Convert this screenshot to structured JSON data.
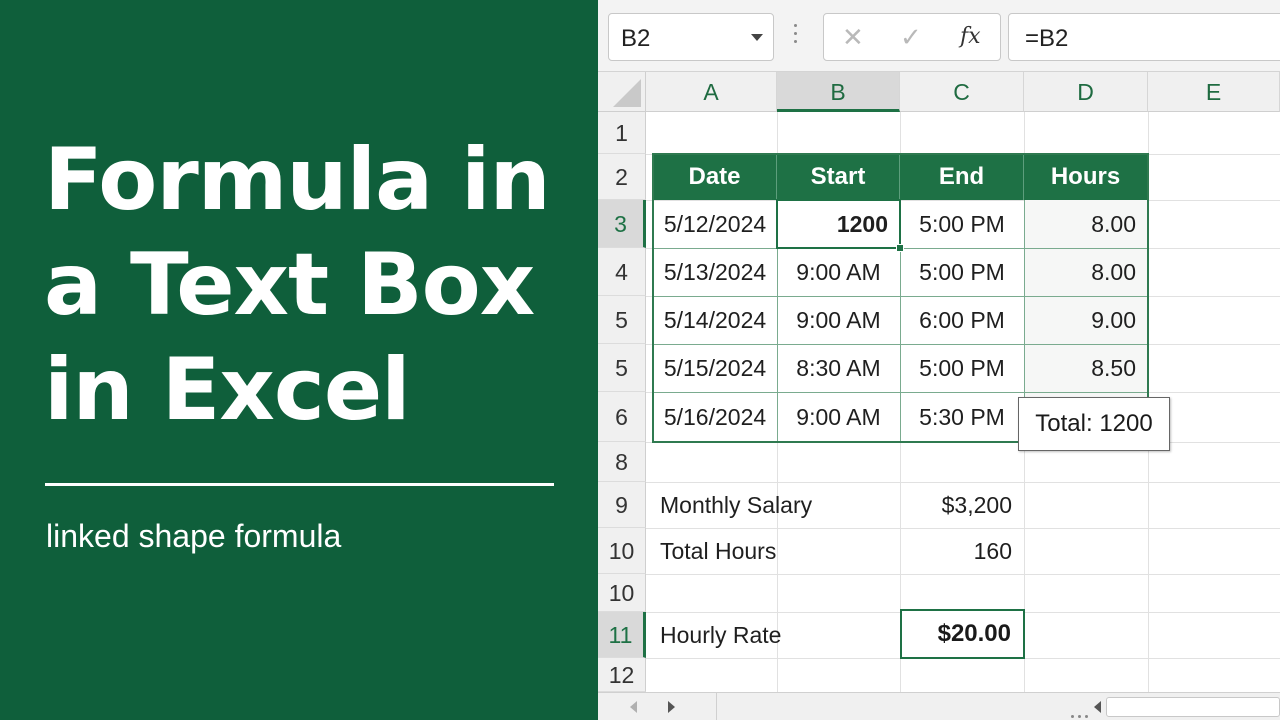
{
  "banner": {
    "title_lines": [
      "Formula in",
      "a Text Box",
      "in Excel"
    ],
    "subtitle": "linked shape formula",
    "bg_color": "#0f5f3b"
  },
  "formula_bar": {
    "name_box": "B2",
    "cancel_icon": "✕",
    "enter_icon": "✓",
    "fx_label": "fx",
    "formula": "=B2"
  },
  "columns": [
    "A",
    "B",
    "C",
    "D",
    "E"
  ],
  "selected_column": "B",
  "rows": [
    "1",
    "2",
    "3",
    "4",
    "5",
    "5",
    "6",
    "8",
    "9",
    "10",
    "10",
    "11",
    "12"
  ],
  "table": {
    "headers": [
      "Date",
      "Start",
      "End",
      "Hours"
    ],
    "rows": [
      [
        "5/12/2024",
        "1200",
        "5:00 PM",
        "8.00"
      ],
      [
        "5/13/2024",
        "9:00 AM",
        "5:00 PM",
        "8.00"
      ],
      [
        "5/14/2024",
        "9:00 AM",
        "6:00 PM",
        "9.00"
      ],
      [
        "5/15/2024",
        "8:30 AM",
        "5:00 PM",
        "8.50"
      ],
      [
        "5/16/2024",
        "9:00 AM",
        "5:30 PM",
        ""
      ]
    ]
  },
  "text_box": "Total: 1200",
  "summary": {
    "salary_label": "Monthly Salary",
    "salary_value": "$3,200",
    "hours_label": "Total Hours",
    "hours_value": "160",
    "rate_label": "Hourly Rate",
    "rate_value": "$20.00"
  },
  "accent_color": "#1e7145"
}
